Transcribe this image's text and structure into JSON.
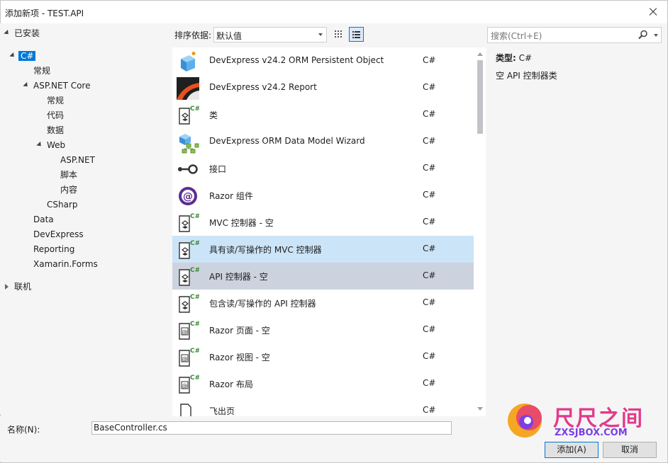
{
  "window": {
    "title": "添加新项 - TEST.API"
  },
  "tree": {
    "installed": "已安装",
    "items": [
      {
        "label": "C#"
      },
      {
        "label": "常规"
      },
      {
        "label": "ASP.NET Core"
      },
      {
        "label": "常规"
      },
      {
        "label": "代码"
      },
      {
        "label": "数据"
      },
      {
        "label": "Web"
      },
      {
        "label": "ASP.NET"
      },
      {
        "label": "脚本"
      },
      {
        "label": "内容"
      },
      {
        "label": "CSharp"
      },
      {
        "label": "Data"
      },
      {
        "label": "DevExpress"
      },
      {
        "label": "Reporting"
      },
      {
        "label": "Xamarin.Forms"
      }
    ],
    "online": "联机"
  },
  "sort": {
    "label": "排序依据:",
    "value": "默认值"
  },
  "search": {
    "placeholder": "搜索(Ctrl+E)"
  },
  "templates": [
    {
      "name": "DevExpress v24.2 ORM Persistent Object",
      "lang": "C#",
      "icon": "orm-object-icon"
    },
    {
      "name": "DevExpress v24.2 Report",
      "lang": "C#",
      "icon": "report-icon"
    },
    {
      "name": "类",
      "lang": "C#",
      "icon": "class-icon"
    },
    {
      "name": "DevExpress ORM Data Model Wizard",
      "lang": "C#",
      "icon": "data-model-icon"
    },
    {
      "name": "接口",
      "lang": "C#",
      "icon": "interface-icon"
    },
    {
      "name": "Razor 组件",
      "lang": "C#",
      "icon": "razor-component-icon"
    },
    {
      "name": "MVC 控制器 - 空",
      "lang": "C#",
      "icon": "controller-icon"
    },
    {
      "name": "具有读/写操作的 MVC 控制器",
      "lang": "C#",
      "icon": "controller-icon"
    },
    {
      "name": "API 控制器 - 空",
      "lang": "C#",
      "icon": "controller-icon"
    },
    {
      "name": "包含读/写操作的 API 控制器",
      "lang": "C#",
      "icon": "controller-icon"
    },
    {
      "name": "Razor 页面 - 空",
      "lang": "C#",
      "icon": "razor-page-icon"
    },
    {
      "name": "Razor 视图 - 空",
      "lang": "C#",
      "icon": "razor-page-icon"
    },
    {
      "name": "Razor 布局",
      "lang": "C#",
      "icon": "razor-page-icon"
    },
    {
      "name": "飞出页",
      "lang": "C#",
      "icon": "page-icon"
    }
  ],
  "details": {
    "type_label": "类型:",
    "type_value": "C#",
    "description": "空 API 控制器类"
  },
  "bottom": {
    "name_label": "名称(N):",
    "name_value": "BaseController.cs",
    "add": "添加(A)",
    "cancel": "取消"
  },
  "watermark": {
    "brand": "尺尺之间",
    "url": "ZXSJBOX.COM"
  },
  "colors": {
    "accent": "#0078d7",
    "hover_row": "#cce4f7",
    "selected_row": "#cdd3de"
  }
}
